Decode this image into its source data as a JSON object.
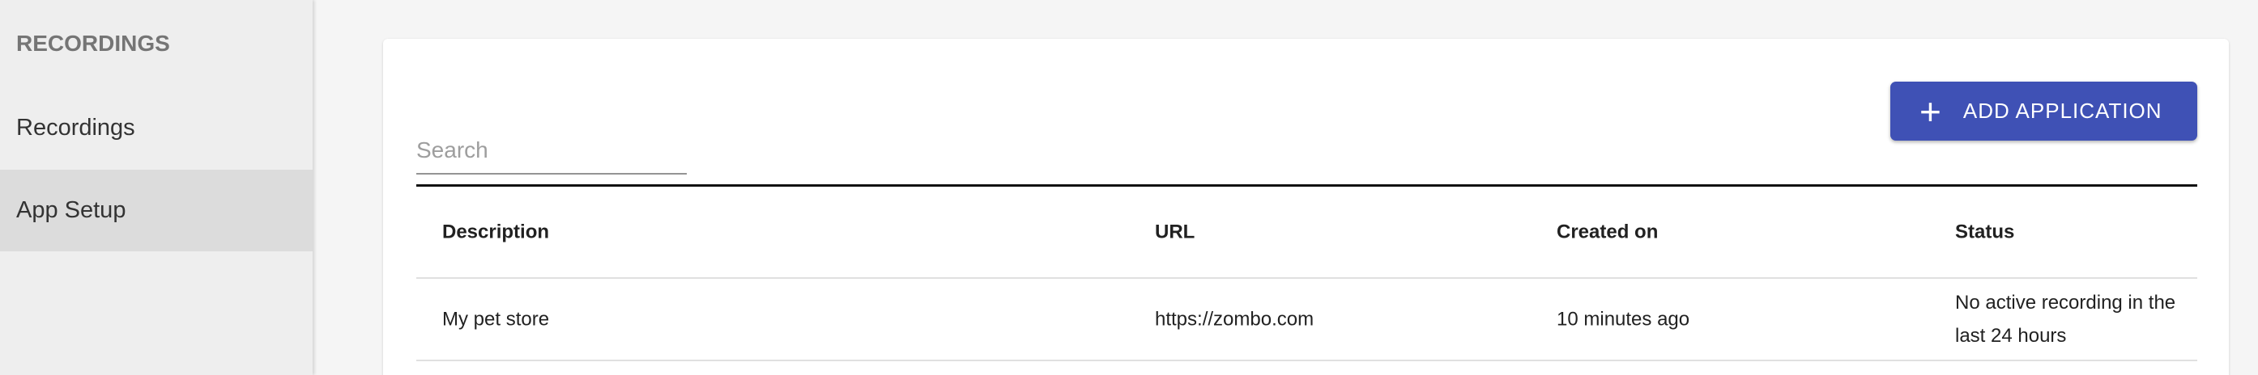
{
  "sidebar": {
    "section_title": "RECORDINGS",
    "items": [
      {
        "label": "Recordings",
        "active": false
      },
      {
        "label": "App Setup",
        "active": true
      }
    ]
  },
  "main": {
    "search": {
      "placeholder": "Search",
      "value": ""
    },
    "add_button": {
      "icon": "plus-icon",
      "label": "ADD APPLICATION",
      "color": "#3f51b5"
    },
    "table": {
      "columns": [
        "Description",
        "URL",
        "Created on",
        "Status"
      ],
      "rows": [
        [
          "My pet store",
          "https://zombo.com",
          "10 minutes ago",
          "No active recording in the last 24 hours"
        ]
      ]
    }
  }
}
